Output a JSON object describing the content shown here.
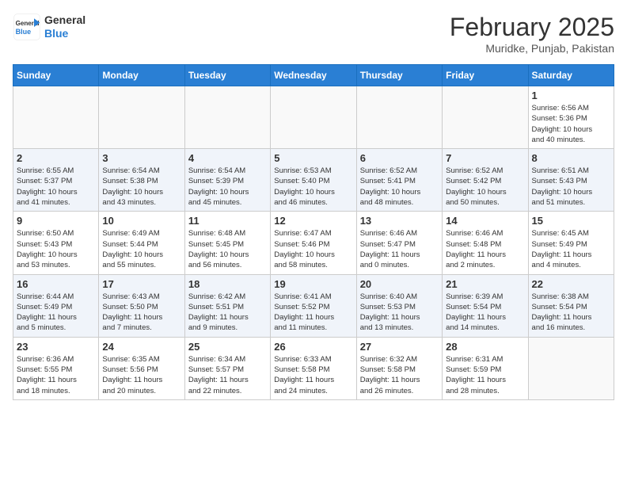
{
  "logo": {
    "line1": "General",
    "line2": "Blue"
  },
  "title": "February 2025",
  "location": "Muridke, Punjab, Pakistan",
  "days_of_week": [
    "Sunday",
    "Monday",
    "Tuesday",
    "Wednesday",
    "Thursday",
    "Friday",
    "Saturday"
  ],
  "weeks": [
    [
      {
        "day": "",
        "info": ""
      },
      {
        "day": "",
        "info": ""
      },
      {
        "day": "",
        "info": ""
      },
      {
        "day": "",
        "info": ""
      },
      {
        "day": "",
        "info": ""
      },
      {
        "day": "",
        "info": ""
      },
      {
        "day": "1",
        "info": "Sunrise: 6:56 AM\nSunset: 5:36 PM\nDaylight: 10 hours\nand 40 minutes."
      }
    ],
    [
      {
        "day": "2",
        "info": "Sunrise: 6:55 AM\nSunset: 5:37 PM\nDaylight: 10 hours\nand 41 minutes."
      },
      {
        "day": "3",
        "info": "Sunrise: 6:54 AM\nSunset: 5:38 PM\nDaylight: 10 hours\nand 43 minutes."
      },
      {
        "day": "4",
        "info": "Sunrise: 6:54 AM\nSunset: 5:39 PM\nDaylight: 10 hours\nand 45 minutes."
      },
      {
        "day": "5",
        "info": "Sunrise: 6:53 AM\nSunset: 5:40 PM\nDaylight: 10 hours\nand 46 minutes."
      },
      {
        "day": "6",
        "info": "Sunrise: 6:52 AM\nSunset: 5:41 PM\nDaylight: 10 hours\nand 48 minutes."
      },
      {
        "day": "7",
        "info": "Sunrise: 6:52 AM\nSunset: 5:42 PM\nDaylight: 10 hours\nand 50 minutes."
      },
      {
        "day": "8",
        "info": "Sunrise: 6:51 AM\nSunset: 5:43 PM\nDaylight: 10 hours\nand 51 minutes."
      }
    ],
    [
      {
        "day": "9",
        "info": "Sunrise: 6:50 AM\nSunset: 5:43 PM\nDaylight: 10 hours\nand 53 minutes."
      },
      {
        "day": "10",
        "info": "Sunrise: 6:49 AM\nSunset: 5:44 PM\nDaylight: 10 hours\nand 55 minutes."
      },
      {
        "day": "11",
        "info": "Sunrise: 6:48 AM\nSunset: 5:45 PM\nDaylight: 10 hours\nand 56 minutes."
      },
      {
        "day": "12",
        "info": "Sunrise: 6:47 AM\nSunset: 5:46 PM\nDaylight: 10 hours\nand 58 minutes."
      },
      {
        "day": "13",
        "info": "Sunrise: 6:46 AM\nSunset: 5:47 PM\nDaylight: 11 hours\nand 0 minutes."
      },
      {
        "day": "14",
        "info": "Sunrise: 6:46 AM\nSunset: 5:48 PM\nDaylight: 11 hours\nand 2 minutes."
      },
      {
        "day": "15",
        "info": "Sunrise: 6:45 AM\nSunset: 5:49 PM\nDaylight: 11 hours\nand 4 minutes."
      }
    ],
    [
      {
        "day": "16",
        "info": "Sunrise: 6:44 AM\nSunset: 5:49 PM\nDaylight: 11 hours\nand 5 minutes."
      },
      {
        "day": "17",
        "info": "Sunrise: 6:43 AM\nSunset: 5:50 PM\nDaylight: 11 hours\nand 7 minutes."
      },
      {
        "day": "18",
        "info": "Sunrise: 6:42 AM\nSunset: 5:51 PM\nDaylight: 11 hours\nand 9 minutes."
      },
      {
        "day": "19",
        "info": "Sunrise: 6:41 AM\nSunset: 5:52 PM\nDaylight: 11 hours\nand 11 minutes."
      },
      {
        "day": "20",
        "info": "Sunrise: 6:40 AM\nSunset: 5:53 PM\nDaylight: 11 hours\nand 13 minutes."
      },
      {
        "day": "21",
        "info": "Sunrise: 6:39 AM\nSunset: 5:54 PM\nDaylight: 11 hours\nand 14 minutes."
      },
      {
        "day": "22",
        "info": "Sunrise: 6:38 AM\nSunset: 5:54 PM\nDaylight: 11 hours\nand 16 minutes."
      }
    ],
    [
      {
        "day": "23",
        "info": "Sunrise: 6:36 AM\nSunset: 5:55 PM\nDaylight: 11 hours\nand 18 minutes."
      },
      {
        "day": "24",
        "info": "Sunrise: 6:35 AM\nSunset: 5:56 PM\nDaylight: 11 hours\nand 20 minutes."
      },
      {
        "day": "25",
        "info": "Sunrise: 6:34 AM\nSunset: 5:57 PM\nDaylight: 11 hours\nand 22 minutes."
      },
      {
        "day": "26",
        "info": "Sunrise: 6:33 AM\nSunset: 5:58 PM\nDaylight: 11 hours\nand 24 minutes."
      },
      {
        "day": "27",
        "info": "Sunrise: 6:32 AM\nSunset: 5:58 PM\nDaylight: 11 hours\nand 26 minutes."
      },
      {
        "day": "28",
        "info": "Sunrise: 6:31 AM\nSunset: 5:59 PM\nDaylight: 11 hours\nand 28 minutes."
      },
      {
        "day": "",
        "info": ""
      }
    ]
  ]
}
